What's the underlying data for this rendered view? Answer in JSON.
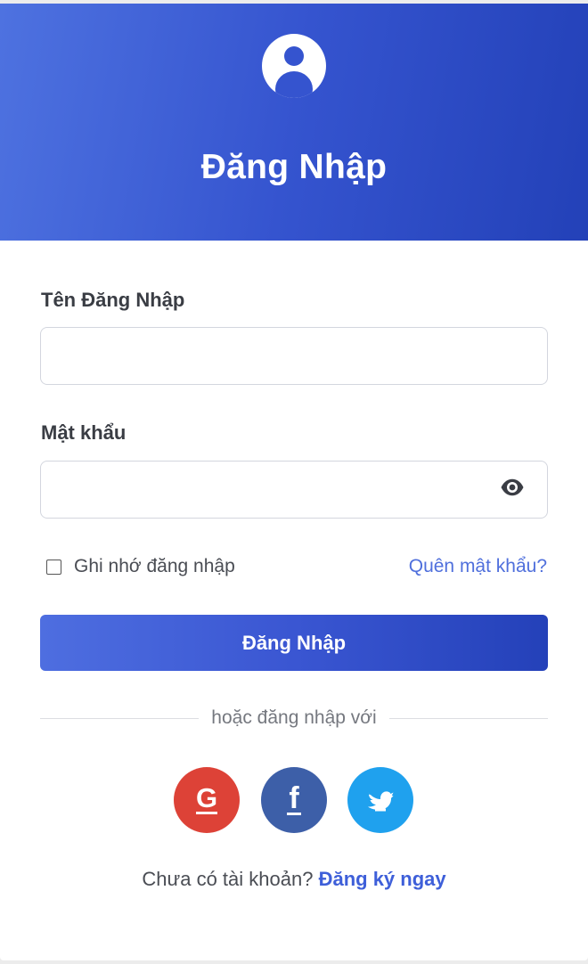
{
  "header": {
    "title": "Đăng Nhập",
    "avatar_icon": "user-circle-icon",
    "gradient": [
      "#4e72e0",
      "#2341b8"
    ]
  },
  "form": {
    "username": {
      "label": "Tên Đăng Nhập",
      "value": "",
      "placeholder": ""
    },
    "password": {
      "label": "Mật khẩu",
      "value": "",
      "placeholder": "",
      "toggle_icon": "eye-icon"
    },
    "remember": {
      "label": "Ghi nhớ đăng nhập",
      "checked": false
    },
    "forgot_link": "Quên mật khẩu?",
    "submit_label": "Đăng Nhập"
  },
  "divider": {
    "text": "hoặc đăng nhập với"
  },
  "social": [
    {
      "name": "google",
      "icon": "google-icon",
      "color": "#dd4237"
    },
    {
      "name": "facebook",
      "icon": "facebook-icon",
      "color": "#3d5fa8"
    },
    {
      "name": "twitter",
      "icon": "twitter-icon",
      "color": "#1fa1ee"
    }
  ],
  "signup": {
    "prompt": "Chưa có tài khoản?",
    "link": "Đăng ký ngay"
  },
  "colors": {
    "accent": "#3554cf",
    "link": "#4f6fdc"
  }
}
